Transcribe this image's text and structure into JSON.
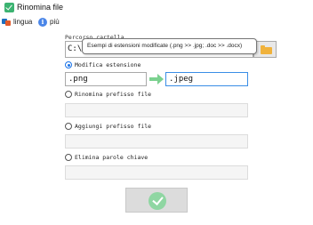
{
  "window": {
    "title": "Rinomina file"
  },
  "menu": {
    "language": "lingua",
    "more": "più"
  },
  "folder": {
    "label": "Percorso cartella",
    "path": "C:\\"
  },
  "tooltip": {
    "text": "Esempi di estensioni modificate (.png >> .jpg; .doc >> .docx)"
  },
  "options": {
    "modify_extension": {
      "label": "Modifica estensione",
      "from": ".png",
      "to": ".jpeg",
      "checked": true
    },
    "rename_prefix": {
      "label": "Rinomina prefisso file",
      "value": ""
    },
    "add_prefix": {
      "label": "Aggiungi prefisso file",
      "value": ""
    },
    "remove_keywords": {
      "label": "Elimina parole chiave",
      "value": ""
    }
  },
  "colors": {
    "accent": "#1a73e8",
    "confirm": "#8fd6a2",
    "arrow": "#7bd18f"
  },
  "icons": {
    "app": "check-icon",
    "language": "language-icon",
    "more": "info-icon",
    "folder": "folder-icon",
    "confirm": "check-circle-icon"
  }
}
